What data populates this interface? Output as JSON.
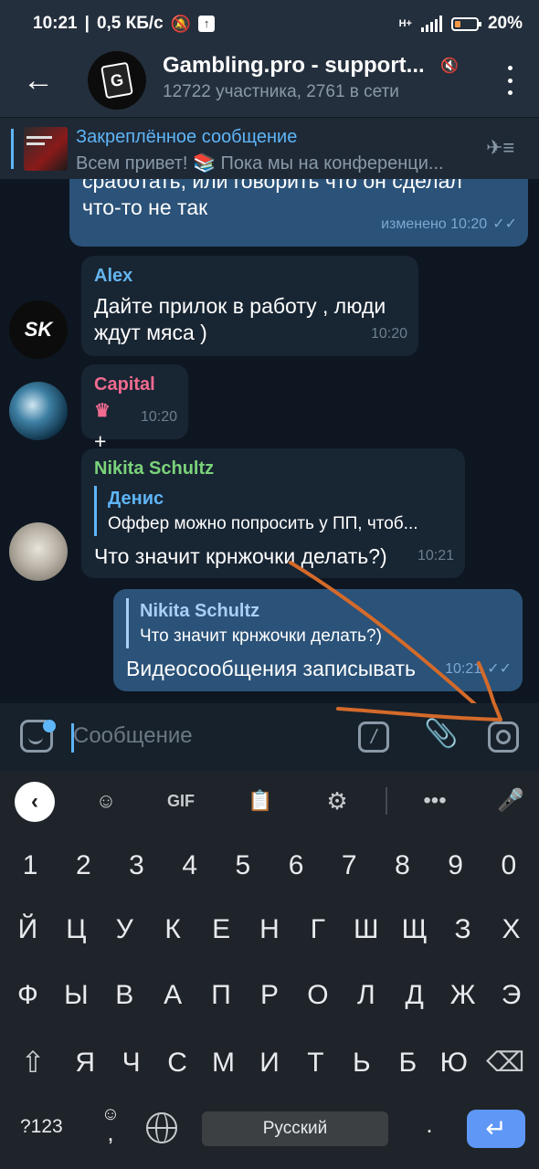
{
  "status_bar": {
    "time": "10:21",
    "speed": "0,5 КБ/с",
    "battery": "20%",
    "network": "H+"
  },
  "header": {
    "title": "Gambling.pro - support...",
    "subtitle": "12722 участника, 2761 в сети"
  },
  "pinned": {
    "title": "Закреплённое сообщение",
    "text": "Всем привет!  📚 Пока мы на конференци...",
    "thumb_text": [
      "CA PRIVATE",
      "Mb 2016"
    ]
  },
  "messages": [
    {
      "id": "m0",
      "type": "out",
      "text_lines": [
        "сработать, или говорить что он сделал",
        "что-то не так"
      ],
      "time": "изменено 10:20",
      "read": true
    },
    {
      "id": "m1",
      "type": "in",
      "sender": "Alex",
      "sender_color": "#64b5ef",
      "text_lines": [
        "Дайте прилок в работу , люди",
        "ждут мяса )"
      ],
      "time": "10:20"
    },
    {
      "id": "m2",
      "type": "in",
      "sender": "Capital",
      "sender_badge": "♛",
      "sender_color": "#ef6b8f",
      "text_lines": [
        "+"
      ],
      "time": "10:20"
    },
    {
      "id": "m3",
      "type": "in",
      "sender": "Nikita Schultz",
      "sender_color": "#7bd37a",
      "reply": {
        "name": "Денис",
        "text": "Оффер можно попросить у ПП, чтоб..."
      },
      "text_lines": [
        "Что значит крнжочки делать?)"
      ],
      "time": "10:21"
    },
    {
      "id": "m4",
      "type": "out",
      "reply": {
        "name": "Nikita Schultz",
        "text": "Что значит крнжочки делать?)"
      },
      "text_lines": [
        "Видеосообщения записывать"
      ],
      "time": "10:21",
      "read": true
    }
  ],
  "avatars": {
    "alex": "SK",
    "chat": "G"
  },
  "input": {
    "placeholder": "Сообщение"
  },
  "keyboard": {
    "toolbar": [
      "back",
      "sticker",
      "GIF",
      "clipboard",
      "settings",
      "more",
      "mic"
    ],
    "gif_label": "GIF",
    "digits": [
      "1",
      "2",
      "3",
      "4",
      "5",
      "6",
      "7",
      "8",
      "9",
      "0"
    ],
    "row1": [
      "Й",
      "Ц",
      "У",
      "К",
      "Е",
      "Н",
      "Г",
      "Ш",
      "Щ",
      "З",
      "Х"
    ],
    "row2": [
      "Ф",
      "Ы",
      "В",
      "А",
      "П",
      "Р",
      "О",
      "Л",
      "Д",
      "Ж",
      "Э"
    ],
    "row3": [
      "Я",
      "Ч",
      "С",
      "М",
      "И",
      "Т",
      "Ь",
      "Б",
      "Ю"
    ],
    "sym_label": "?123",
    "comma": ",",
    "space_label": "Русский",
    "period": "."
  },
  "colors": {
    "accent": "#5eb5f7",
    "annotation_arrow": "#d46a2a",
    "outgoing_bubble": "#2b5278",
    "incoming_bubble": "#182533"
  }
}
